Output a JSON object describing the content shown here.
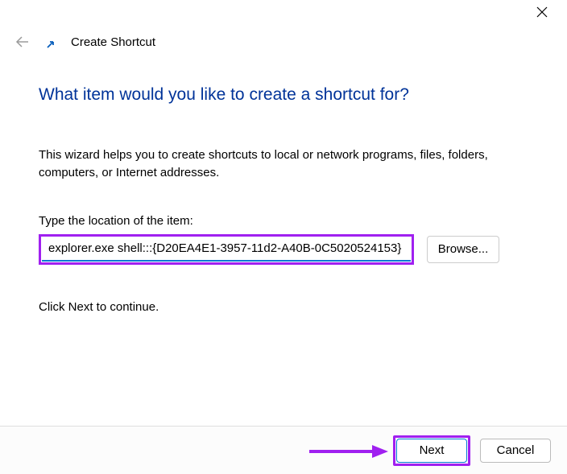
{
  "header": {
    "title": "Create Shortcut"
  },
  "main": {
    "title": "What item would you like to create a shortcut for?",
    "description": "This wizard helps you to create shortcuts to local or network programs, files, folders, computers, or Internet addresses.",
    "input_label": "Type the location of the item:",
    "input_value": "explorer.exe shell:::{D20EA4E1-3957-11d2-A40B-0C5020524153}",
    "browse_label": "Browse...",
    "continue_text": "Click Next to continue."
  },
  "footer": {
    "next_label": "Next",
    "cancel_label": "Cancel"
  },
  "annotations": {
    "highlight_color": "#a020f0"
  }
}
